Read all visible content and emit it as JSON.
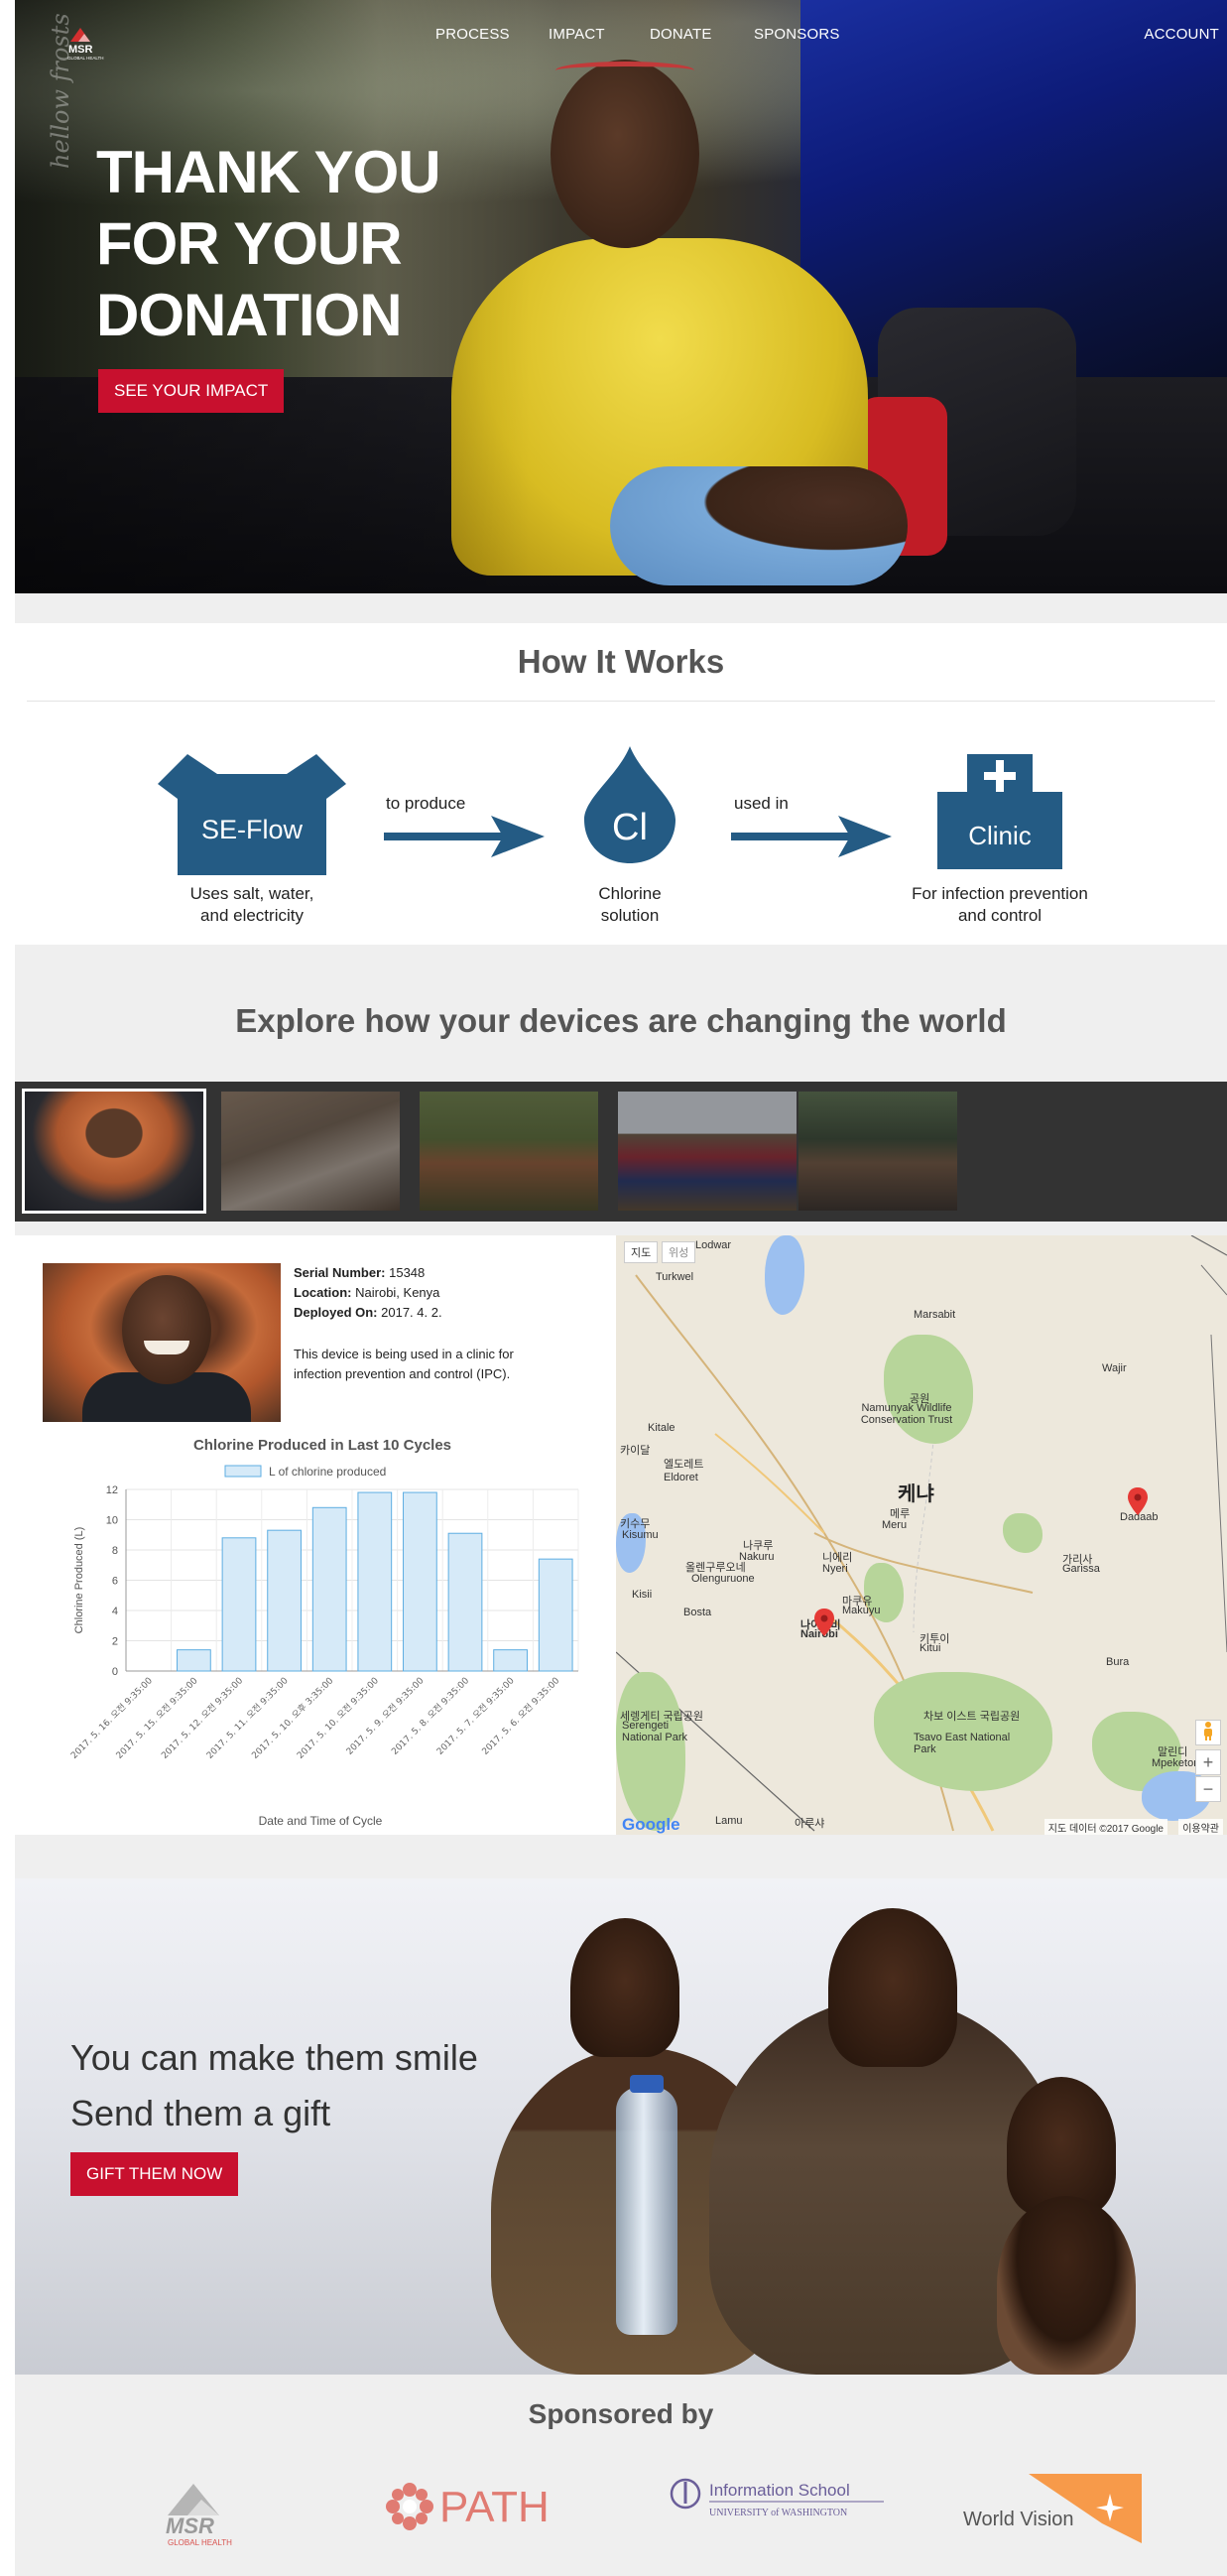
{
  "nav": {
    "items": [
      "PROCESS",
      "IMPACT",
      "DONATE",
      "SPONSORS"
    ],
    "account": "ACCOUNT",
    "logo_text": "MSR",
    "logo_subtext": "GLOBAL HEALTH"
  },
  "hero": {
    "title_lines": [
      "THANK YOU",
      "FOR YOUR",
      "DONATION"
    ],
    "script_text": "hellow frosts",
    "cta": "SEE YOUR IMPACT"
  },
  "how_it_works": {
    "title": "How It Works",
    "steps": [
      {
        "label": "SE-Flow",
        "caption_lines": [
          "Uses salt, water,",
          "and electricity"
        ]
      },
      {
        "label": "Cl",
        "caption_lines": [
          "Chlorine",
          "solution"
        ]
      },
      {
        "label": "Clinic",
        "caption_lines": [
          "For infection prevention",
          "and control"
        ]
      }
    ],
    "arrows": [
      "to produce",
      "used in"
    ],
    "colors": {
      "primary": "#245b84"
    }
  },
  "explore": {
    "title": "Explore how your devices are changing the world",
    "thumbnails": [
      "boy-smiling",
      "woman-washing",
      "group-outdoors",
      "people-in-red",
      "children-group"
    ],
    "active_index": 0
  },
  "device": {
    "serial_label": "Serial Number:",
    "serial": "15348",
    "location_label": "Location:",
    "location": "Nairobi, Kenya",
    "deployed_label": "Deployed On:",
    "deployed": "2017. 4. 2.",
    "description": "This device is being used in a clinic for infection prevention and control (IPC)."
  },
  "chart_data": {
    "type": "bar",
    "title": "Chlorine Produced in Last 10 Cycles",
    "series": [
      {
        "name": "L of chlorine produced",
        "values": [
          0,
          1.4,
          8.8,
          9.3,
          10.8,
          11.8,
          11.8,
          9.1,
          1.4,
          7.4
        ]
      }
    ],
    "categories": [
      "2017. 5. 16. 오전 9:35:00",
      "2017. 5. 15. 오전 9:35:00",
      "2017. 5. 12. 오전 9:35:00",
      "2017. 5. 11. 오전 9:35:00",
      "2017. 5. 10. 오후 3:35:00",
      "2017. 5. 10. 오전 9:35:00",
      "2017. 5. 9. 오전 9:35:00",
      "2017. 5. 8. 오전 9:35:00",
      "2017. 5. 7. 오전 9:35:00",
      "2017. 5. 6. 오전 9:35:00"
    ],
    "xlabel": "Date and Time of Cycle",
    "ylabel": "Chlorine Produced (L)",
    "ylim": [
      0,
      12
    ],
    "yticks": [
      0,
      2,
      4,
      6,
      8,
      10,
      12
    ],
    "grid": true,
    "legend": "top-center",
    "bar_color": "#d6eaf8",
    "bar_stroke": "#5dade2"
  },
  "map": {
    "tabs": [
      "지도",
      "위성"
    ],
    "country": "케냐",
    "places": [
      "Lodwar",
      "Turkwel",
      "Marsabit",
      "Wajir",
      "Kitale",
      "Eldoret",
      "Namunyak Wildlife Conservation Trust",
      "Kisumu",
      "Nakuru",
      "Meru",
      "Nyeri",
      "Olenguruone",
      "Kisii",
      "Bosta",
      "Makuyu",
      "Nairobi",
      "Kitui",
      "Garissa",
      "Dadaab",
      "Bura",
      "Serengeti National Park",
      "Tsavo East National Park",
      "Mpeketoni",
      "Lamu"
    ],
    "places_ko": [
      "카이달",
      "엘도레트",
      "키수무",
      "나쿠루",
      "니에리",
      "메루",
      "올렌구루오네",
      "마쿠유",
      "나이로비",
      "키투이",
      "가리사",
      "공원",
      "세렝게티 국립공원",
      "차보 이스트 국립공원",
      "아루샤",
      "말린디"
    ],
    "credit": "지도 데이터 ©2017 Google",
    "terms": "이용약관",
    "google": "Google",
    "zoom_in": "+",
    "zoom_out": "−"
  },
  "gift": {
    "line1": "You can make them smile",
    "line2": "Send them a gift",
    "cta": "GIFT THEM NOW"
  },
  "sponsors": {
    "title": "Sponsored by",
    "logos": [
      {
        "name": "MSR",
        "sub": "GLOBAL HEALTH"
      },
      {
        "name": "PATH"
      },
      {
        "name": "Information School",
        "sub": "UNIVERSITY of WASHINGTON"
      },
      {
        "name": "World Vision"
      }
    ]
  },
  "colors": {
    "accent": "#c8102e",
    "brand_blue": "#245b84",
    "bg_gray": "#efefef",
    "strip": "#333333"
  }
}
